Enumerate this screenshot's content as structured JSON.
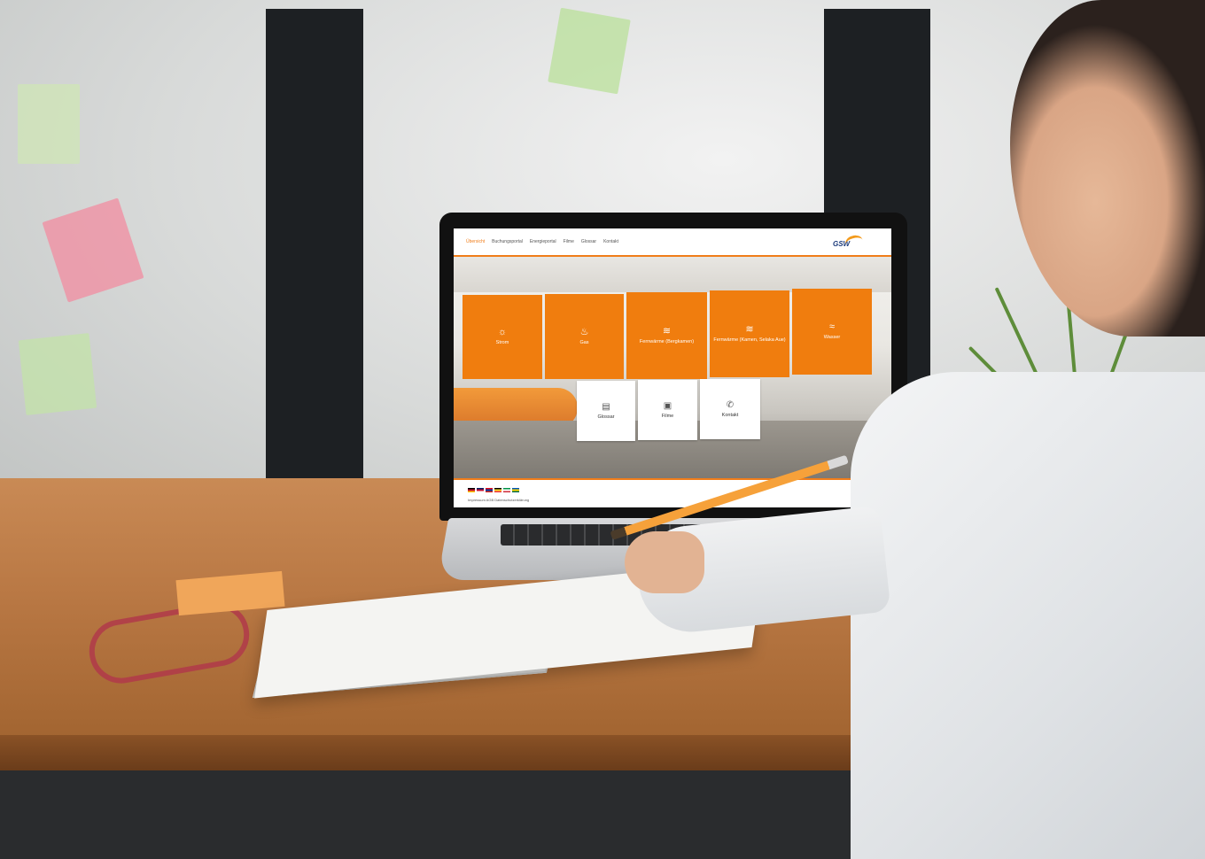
{
  "website": {
    "nav": [
      {
        "label": "Übersicht",
        "active": true
      },
      {
        "label": "Buchungsportal",
        "active": false
      },
      {
        "label": "Energieportal",
        "active": false
      },
      {
        "label": "Filme",
        "active": false
      },
      {
        "label": "Glossar",
        "active": false
      },
      {
        "label": "Kontakt",
        "active": false
      }
    ],
    "logo_text": "GSW",
    "orange_tiles": [
      {
        "label": "Strom",
        "icon": "lightbulb-icon",
        "glyph": "☼"
      },
      {
        "label": "Gas",
        "icon": "flame-drop-icon",
        "glyph": "♨"
      },
      {
        "label": "Fernwärme (Bergkamen)",
        "icon": "heat-waves-icon",
        "glyph": "≋"
      },
      {
        "label": "Fernwärme (Kamen, Selaka Aue)",
        "icon": "heat-waves-icon",
        "glyph": "≋"
      },
      {
        "label": "Wasser",
        "icon": "water-waves-icon",
        "glyph": "≈"
      }
    ],
    "white_tiles": [
      {
        "label": "Glossar",
        "icon": "book-icon",
        "glyph": "▤"
      },
      {
        "label": "Filme",
        "icon": "film-camera-icon",
        "glyph": "▣"
      },
      {
        "label": "Kontakt",
        "icon": "phone-contact-icon",
        "glyph": "✆"
      }
    ],
    "footer_links": "Impressum AGB Datenschutzerklärung",
    "flag_colors": [
      "#000000",
      "#c8102e",
      "#ffcc00",
      "#012169",
      "#c8102e",
      "#ffffff",
      "#e30a17",
      "#0039a6",
      "#d52b1e",
      "#000000",
      "#fdda24",
      "#ef3340",
      "#009246",
      "#ffffff",
      "#ce2b37",
      "#0057b7",
      "#ffd700",
      "#006a4e"
    ],
    "accent_color": "#f07d0e"
  }
}
